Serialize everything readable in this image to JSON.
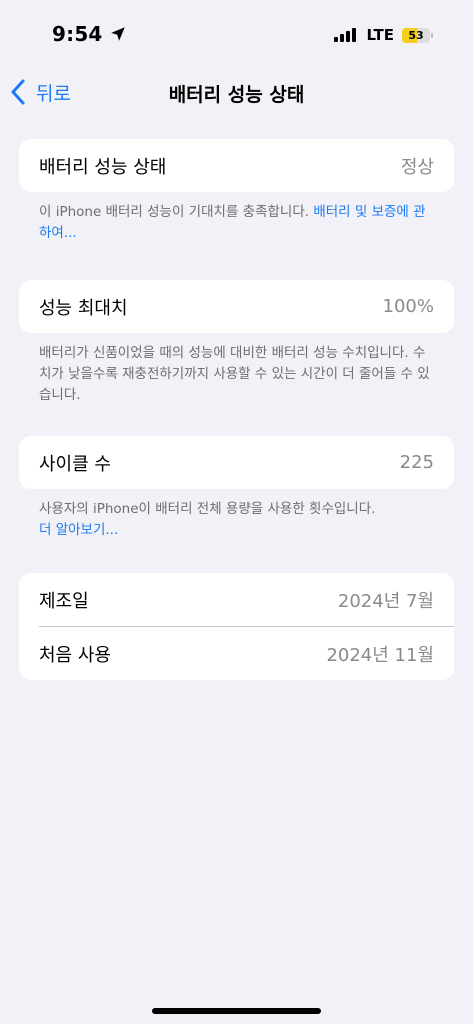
{
  "status_bar": {
    "time": "9:54",
    "network": "LTE",
    "battery_level": "53",
    "battery_percent": 53,
    "battery_color": "#f7cd1b",
    "icons": [
      "location-arrow-icon",
      "signal-bars-icon",
      "battery-icon"
    ]
  },
  "nav": {
    "back_label": "뒤로",
    "title": "배터리 성능 상태"
  },
  "sections": {
    "health": {
      "label": "배터리 성능 상태",
      "value": "정상",
      "footnote_text": "이 iPhone 배터리 성능이 기대치를 충족합니다. ",
      "footnote_link": "배터리 및 보증에 관하여..."
    },
    "capacity": {
      "label": "성능 최대치",
      "value": "100%",
      "footnote_text": "배터리가 신품이었을 때의 성능에 대비한 배터리 성능 수치입니다. 수치가 낮을수록 재충전하기까지 사용할 수 있는 시간이 더 줄어들 수 있습니다."
    },
    "cycles": {
      "label": "사이클 수",
      "value": "225",
      "footnote_text": "사용자의 iPhone이 배터리 전체 용량을 사용한 횟수입니다.",
      "footnote_link": "더 알아보기..."
    },
    "dates": {
      "manufacture_label": "제조일",
      "manufacture_value": "2024년 7월",
      "first_use_label": "처음 사용",
      "first_use_value": "2024년 11월"
    }
  },
  "colors": {
    "accent": "#1a7cf3",
    "background": "#f2f1f7",
    "secondary_text": "#8a8a8e"
  }
}
